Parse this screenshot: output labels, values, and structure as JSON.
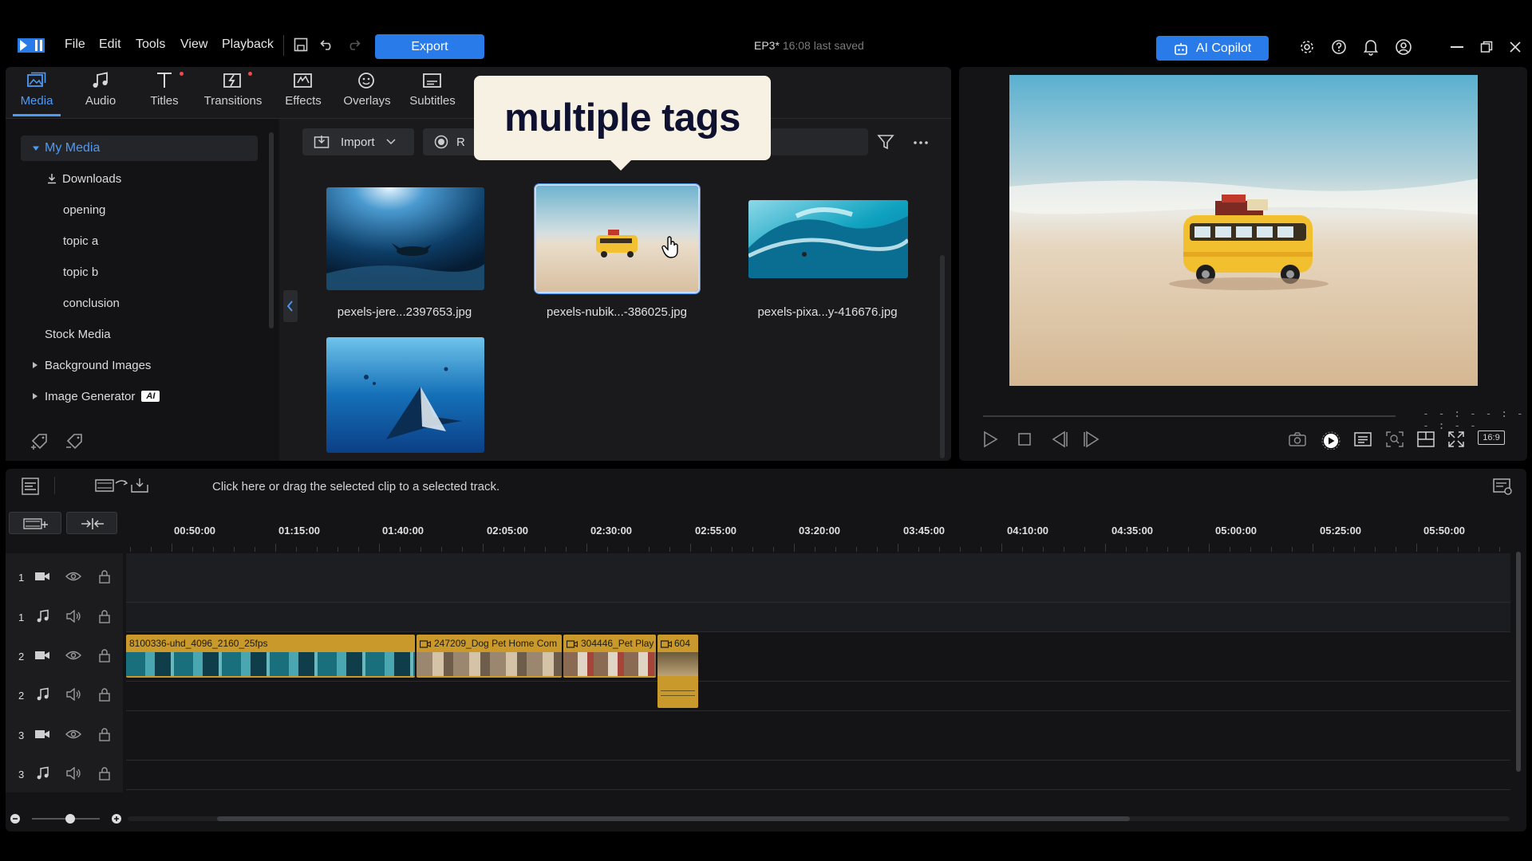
{
  "menu": {
    "items": [
      "File",
      "Edit",
      "Tools",
      "View",
      "Playback"
    ],
    "export_label": "Export"
  },
  "project": {
    "name": "EP3*",
    "saved": "16:08 last saved"
  },
  "copilot_label": "AI Copilot",
  "library_tabs": [
    "Media",
    "Audio",
    "Titles",
    "Transitions",
    "Effects",
    "Overlays",
    "Subtitles"
  ],
  "tree": {
    "my_media": "My Media",
    "downloads": "Downloads",
    "opening": "opening",
    "topic_a": "topic a",
    "topic_b": "topic b",
    "conclusion": "conclusion",
    "stock_media": "Stock Media",
    "background_images": "Background Images",
    "image_generator": "Image Generator",
    "ai_badge": "AI"
  },
  "toolbar": {
    "import_label": "Import",
    "record_label": "R"
  },
  "media_files": [
    "pexels-jere...2397653.jpg",
    "pexels-nubik...-386025.jpg",
    "pexels-pixa...y-416676.jpg"
  ],
  "tooltip": "multiple tags",
  "preview": {
    "timecode": "- - : - - : - - : - -",
    "aspect": "16:9"
  },
  "timeline": {
    "hint": "Click here or drag the selected clip to a selected track.",
    "ruler": [
      "00:50:00",
      "01:15:00",
      "01:40:00",
      "02:05:00",
      "02:30:00",
      "02:55:00",
      "03:20:00",
      "03:45:00",
      "04:10:00",
      "04:35:00",
      "05:00:00",
      "05:25:00",
      "05:50:00"
    ],
    "track_numbers": [
      "1",
      "1",
      "2",
      "2",
      "3",
      "3"
    ],
    "clips": [
      "8100336-uhd_4096_2160_25fps",
      "247209_Dog Pet Home Com",
      "304446_Pet Play",
      "604"
    ]
  },
  "colors": {
    "accent": "#2a7bea",
    "clip": "#c99a2b",
    "tooltip_bg": "#f6f1e3"
  }
}
